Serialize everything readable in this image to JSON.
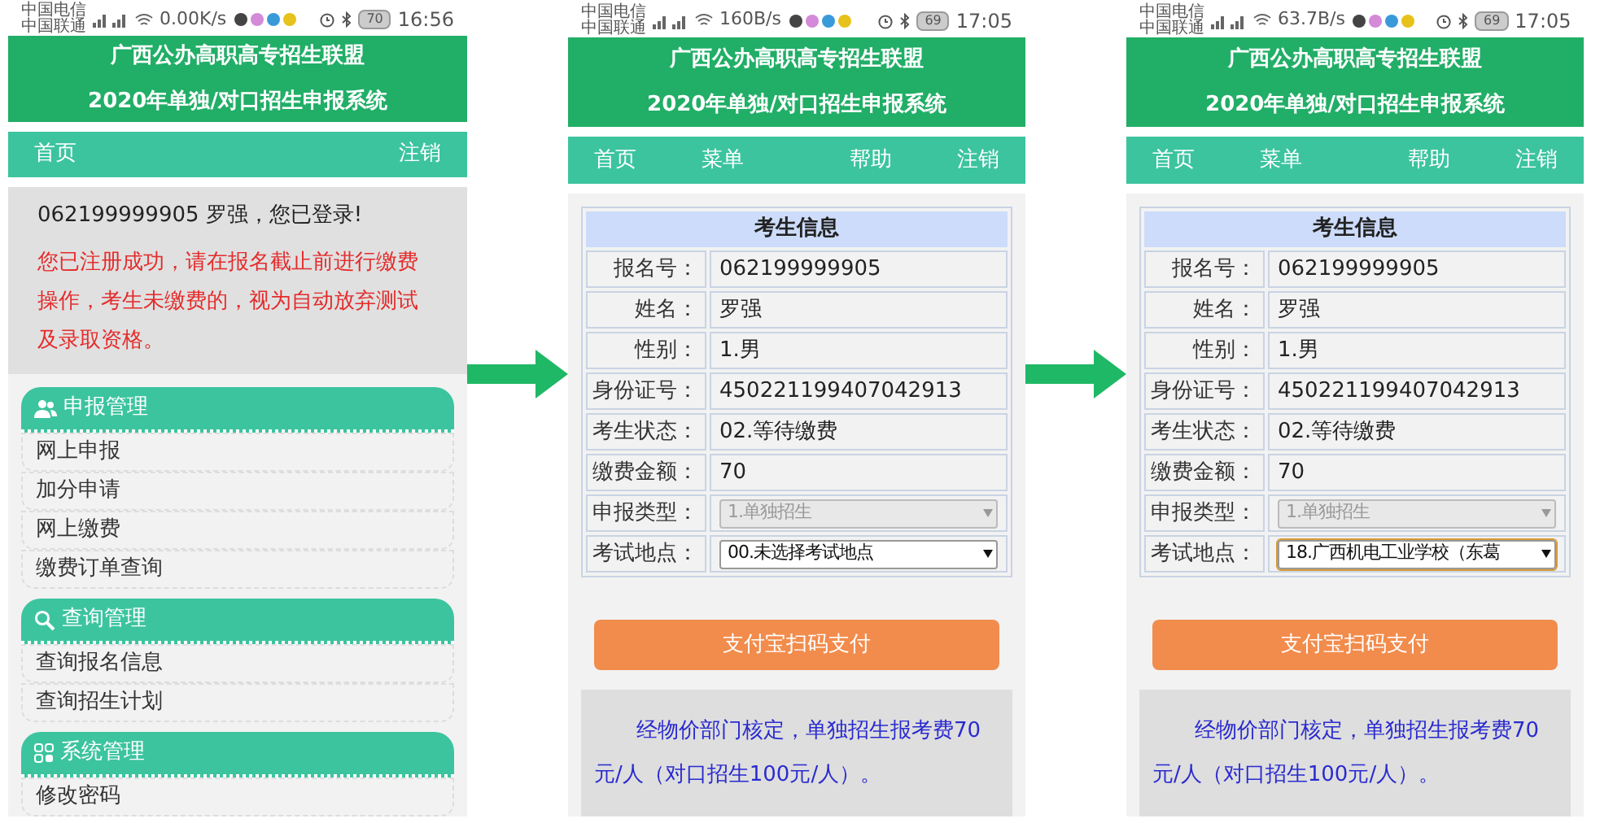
{
  "screens": [
    {
      "kind": "home",
      "status_bar": {
        "carriers": [
          "中国电信",
          "中国联通"
        ],
        "speed": "0.00K/s",
        "battery": "70",
        "time": "16:56"
      },
      "header": {
        "title": "广西公办高职高专招生联盟",
        "subtitle": "2020年单独/对口招生申报系统"
      },
      "nav": {
        "left": [
          "首页"
        ],
        "right": [
          "注销"
        ]
      },
      "login_line": "062199999905 罗强，您已登录!",
      "notice": "您已注册成功，请在报名截止前进行缴费操作，考生未缴费的，视为自动放弃测试及录取资格。",
      "menu_groups": [
        {
          "title": "申报管理",
          "items": [
            "网上申报",
            "加分申请",
            "网上缴费",
            "缴费订单查询"
          ]
        },
        {
          "title": "查询管理",
          "items": [
            "查询报名信息",
            "查询招生计划"
          ]
        },
        {
          "title": "系统管理",
          "items": [
            "修改密码"
          ]
        }
      ]
    },
    {
      "kind": "info",
      "status_bar": {
        "carriers": [
          "中国电信",
          "中国联通"
        ],
        "speed": "160B/s",
        "battery": "69",
        "time": "17:05"
      },
      "header": {
        "title": "广西公办高职高专招生联盟",
        "subtitle": "2020年单独/对口招生申报系统"
      },
      "nav": {
        "left": [
          "首页",
          "菜单"
        ],
        "right": [
          "帮助",
          "注销"
        ]
      },
      "table_title": "考生信息",
      "rows": [
        {
          "kind": "text",
          "label": "报名号：",
          "value": "062199999905"
        },
        {
          "kind": "text",
          "label": "姓名：",
          "value": "罗强"
        },
        {
          "kind": "text",
          "label": "性别：",
          "value": "1.男"
        },
        {
          "kind": "text",
          "label": "身份证号：",
          "value": "450221199407042913"
        },
        {
          "kind": "text",
          "label": "考生状态：",
          "value": "02.等待缴费"
        },
        {
          "kind": "text",
          "label": "缴费金额：",
          "value": "70"
        },
        {
          "kind": "select",
          "label": "申报类型：",
          "value": "1.单独招生",
          "disabled": true,
          "focused": false
        },
        {
          "kind": "select",
          "label": "考试地点：",
          "value": "00.未选择考试地点",
          "disabled": false,
          "focused": false
        }
      ],
      "pay_button": "支付宝扫码支付",
      "fee_note": "经物价部门核定，单独招生报考费70元/人（对口招生100元/人）。"
    },
    {
      "kind": "info",
      "status_bar": {
        "carriers": [
          "中国电信",
          "中国联通"
        ],
        "speed": "63.7B/s",
        "battery": "69",
        "time": "17:05"
      },
      "header": {
        "title": "广西公办高职高专招生联盟",
        "subtitle": "2020年单独/对口招生申报系统"
      },
      "nav": {
        "left": [
          "首页",
          "菜单"
        ],
        "right": [
          "帮助",
          "注销"
        ]
      },
      "table_title": "考生信息",
      "rows": [
        {
          "kind": "text",
          "label": "报名号：",
          "value": "062199999905"
        },
        {
          "kind": "text",
          "label": "姓名：",
          "value": "罗强"
        },
        {
          "kind": "text",
          "label": "性别：",
          "value": "1.男"
        },
        {
          "kind": "text",
          "label": "身份证号：",
          "value": "450221199407042913"
        },
        {
          "kind": "text",
          "label": "考生状态：",
          "value": "02.等待缴费"
        },
        {
          "kind": "text",
          "label": "缴费金额：",
          "value": "70"
        },
        {
          "kind": "select",
          "label": "申报类型：",
          "value": "1.单独招生",
          "disabled": true,
          "focused": false
        },
        {
          "kind": "select",
          "label": "考试地点：",
          "value": "18.广西机电工业学校（东葛",
          "disabled": false,
          "focused": true
        }
      ],
      "pay_button": "支付宝扫码支付",
      "fee_note": "经物价部门核定，单独招生报考费70元/人（对口招生100元/人）。"
    }
  ]
}
